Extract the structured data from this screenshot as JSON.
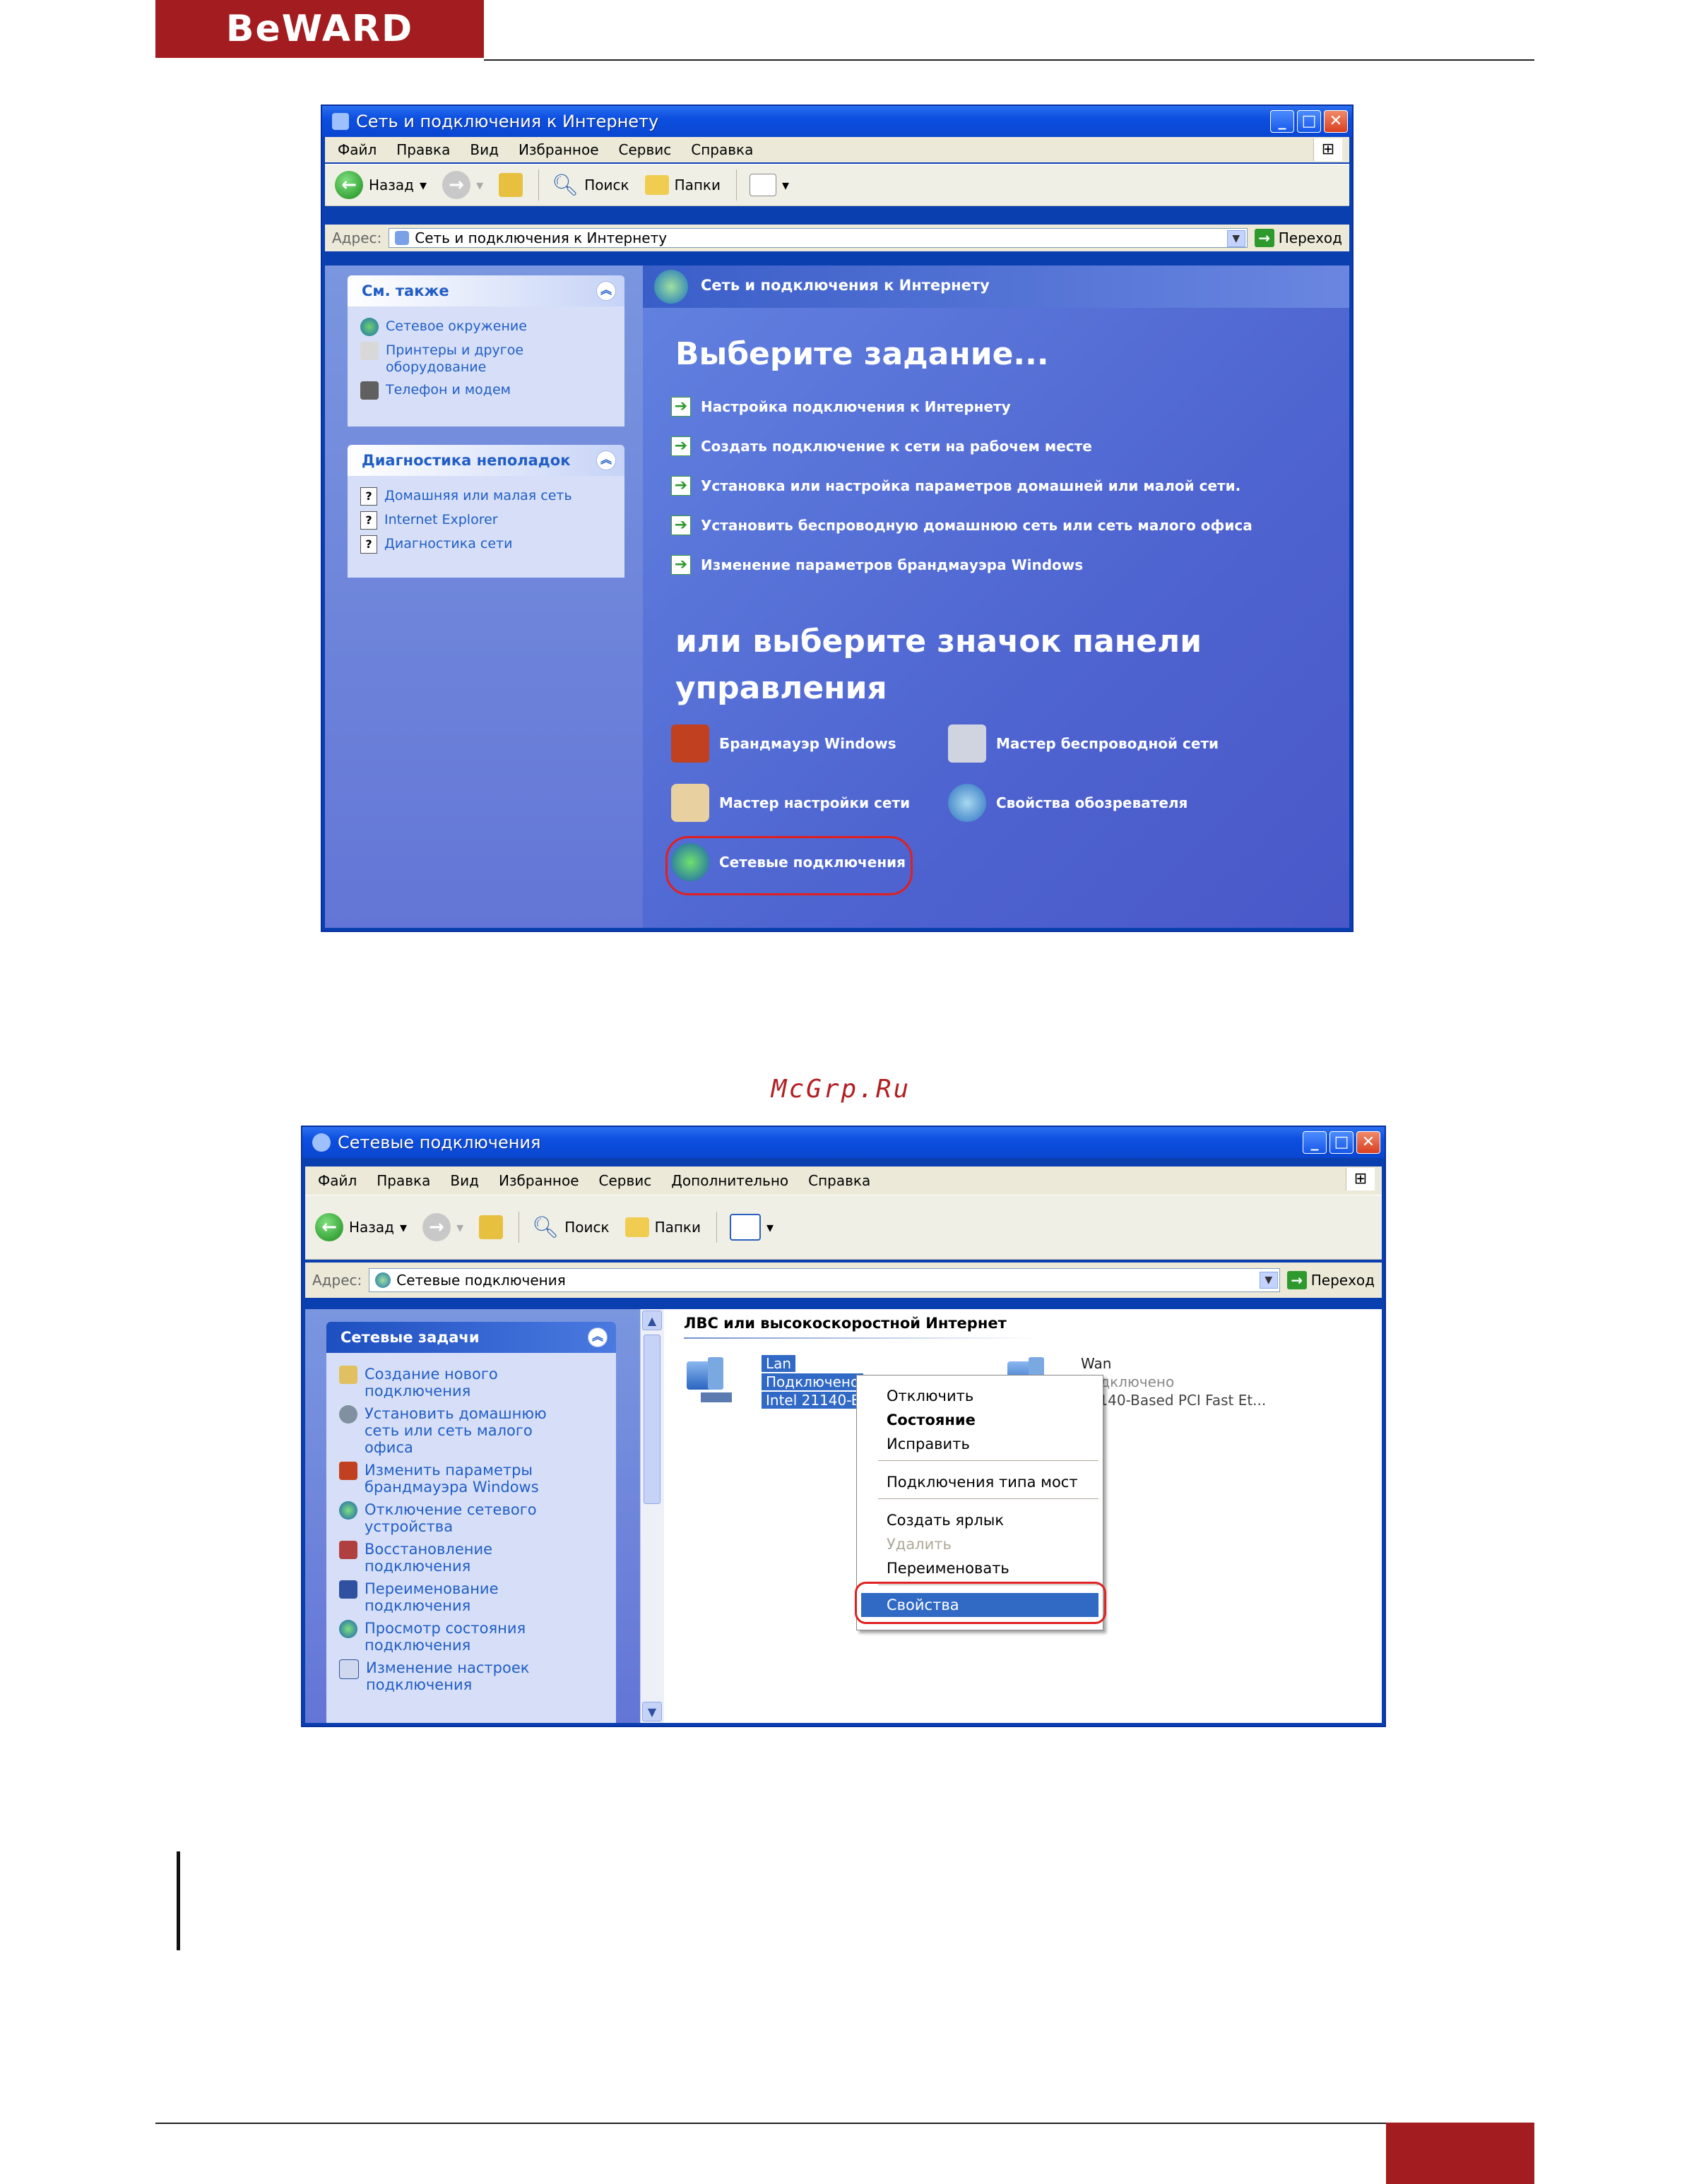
{
  "brand": {
    "logo_text": "BeWARD"
  },
  "site_caption": "McGrp.Ru",
  "window1": {
    "title": "Сеть и подключения к Интернету",
    "menu": [
      "Файл",
      "Правка",
      "Вид",
      "Избранное",
      "Сервис",
      "Справка"
    ],
    "toolbar": {
      "back": "Назад",
      "search": "Поиск",
      "folders": "Папки"
    },
    "address": {
      "label": "Адрес:",
      "value": "Сеть и подключения к Интернету",
      "go": "Переход"
    },
    "see_also": {
      "title": "См. также",
      "items": [
        "Сетевое окружение",
        "Принтеры и другое оборудование",
        "Телефон и модем"
      ]
    },
    "troubleshoot": {
      "title": "Диагностика неполадок",
      "items": [
        "Домашняя или малая сеть",
        "Internet Explorer",
        "Диагностика сети"
      ]
    },
    "header": "Сеть и подключения к Интернету",
    "pick_task": "Выберите задание...",
    "tasks": [
      "Настройка подключения к Интернету",
      "Создать подключение к сети на рабочем месте",
      "Установка или настройка параметров домашней или малой сети.",
      "Установить беспроводную домашнюю сеть или сеть малого офиса",
      "Изменение параметров брандмауэра Windows"
    ],
    "pick_icon_line1": "или выберите значок панели",
    "pick_icon_line2": "управления",
    "icons": [
      "Брандмауэр Windows",
      "Мастер беспроводной сети",
      "Мастер настройки сети",
      "Свойства обозревателя",
      "Сетевые подключения"
    ]
  },
  "window2": {
    "title": "Сетевые подключения",
    "menu": [
      "Файл",
      "Правка",
      "Вид",
      "Избранное",
      "Сервис",
      "Дополнительно",
      "Справка"
    ],
    "toolbar": {
      "back": "Назад",
      "search": "Поиск",
      "folders": "Папки"
    },
    "address": {
      "label": "Адрес:",
      "value": "Сетевые подключения",
      "go": "Переход"
    },
    "tasks_panel": {
      "title": "Сетевые задачи",
      "items": [
        "Создание нового подключения",
        "Установить домашнюю сеть или сеть малого офиса",
        "Изменить параметры брандмауэра Windows",
        "Отключение сетевого устройства",
        "Восстановление подключения",
        "Переименование подключения",
        "Просмотр состояния подключения",
        "Изменение настроек подключения"
      ]
    },
    "group_header": "ЛВС или высокоскоростной Интернет",
    "lan": {
      "name": "Lan",
      "status": "Подключено",
      "device": "Intel 21140-Bas"
    },
    "wan": {
      "name": "Wan",
      "status": "Подключено",
      "device": "21140-Based PCI Fast Et..."
    },
    "context_menu": [
      "Отключить",
      "Состояние",
      "Исправить",
      "Подключения типа мост",
      "Создать ярлык",
      "Удалить",
      "Переименовать",
      "Свойства"
    ]
  }
}
